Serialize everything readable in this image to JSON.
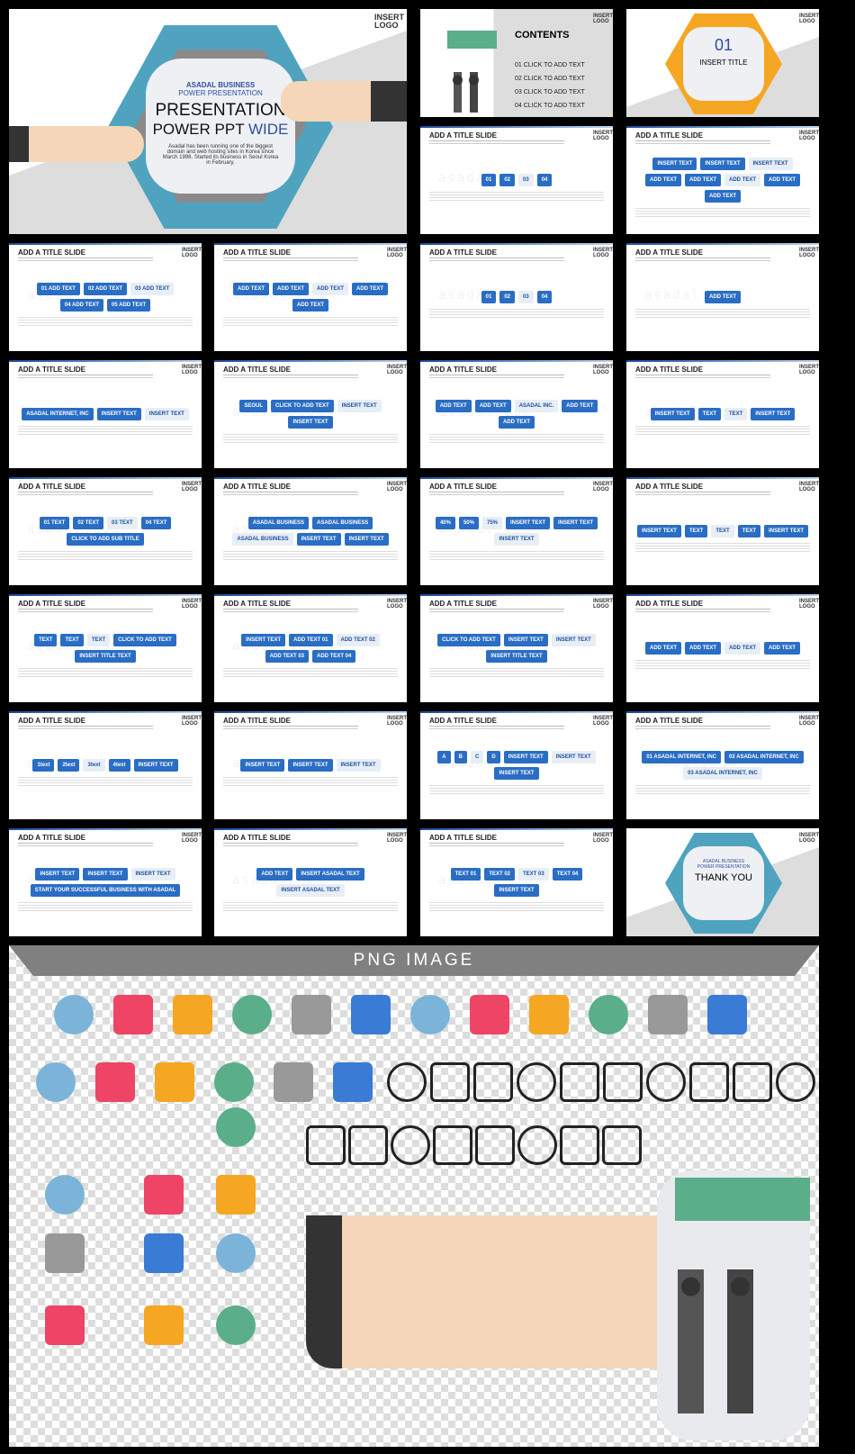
{
  "watermark": "asadal.com",
  "logo": "INSERT LOGO",
  "title_slide": {
    "kicker1": "ASADAL BUSINESS",
    "kicker2": "POWER PRESENTATION",
    "line1": "PRESENTATION",
    "line2a": "POWER PPT ",
    "line2b": "WIDE",
    "body": "Asadal has been running one of the biggest domain and web hosting sites in Korea since March 1998. Started its business in Seoul Korea in February."
  },
  "contents_slide": {
    "title": "CONTENTS",
    "items": [
      "01 CLICK TO ADD TEXT",
      "02 CLICK TO ADD TEXT",
      "03 CLICK TO ADD TEXT",
      "04 CLICK TO ADD TEXT"
    ]
  },
  "section_slide": {
    "number": "01",
    "title": "INSERT TITLE"
  },
  "slide_title": "ADD A TITLE SLIDE",
  "slides": [
    {
      "labels": [
        "01",
        "02",
        "03",
        "04"
      ]
    },
    {
      "labels": [
        "INSERT TEXT",
        "INSERT TEXT",
        "INSERT TEXT",
        "ADD TEXT",
        "ADD TEXT",
        "ADD TEXT",
        "ADD TEXT",
        "ADD TEXT"
      ]
    },
    {
      "labels": [
        "01 ADD TEXT",
        "02 ADD TEXT",
        "03 ADD TEXT",
        "04 ADD TEXT",
        "05 ADD TEXT"
      ]
    },
    {
      "labels": [
        "ADD TEXT",
        "ADD TEXT",
        "ADD TEXT",
        "ADD TEXT",
        "ADD TEXT"
      ]
    },
    {
      "labels": [
        "01",
        "02",
        "03",
        "04"
      ]
    },
    {
      "labels": [
        "ADD TEXT"
      ]
    },
    {
      "labels": [
        "ASADAL INTERNET, INC",
        "INSERT TEXT",
        "INSERT TEXT"
      ]
    },
    {
      "labels": [
        "SEOUL",
        "CLICK TO ADD TEXT",
        "INSERT TEXT",
        "INSERT TEXT"
      ]
    },
    {
      "labels": [
        "ADD TEXT",
        "ADD TEXT",
        "ASADAL INC.",
        "ADD TEXT",
        "ADD TEXT"
      ]
    },
    {
      "labels": [
        "INSERT TEXT",
        "TEXT",
        "TEXT",
        "INSERT TEXT"
      ]
    },
    {
      "labels": [
        "01 TEXT",
        "02 TEXT",
        "03 TEXT",
        "04 TEXT",
        "CLICK TO ADD SUB TITLE"
      ]
    },
    {
      "labels": [
        "ASADAL BUSINESS",
        "ASADAL BUSINESS",
        "ASADAL BUSINESS",
        "INSERT TEXT",
        "INSERT TEXT"
      ]
    },
    {
      "labels": [
        "40%",
        "50%",
        "75%",
        "INSERT TEXT",
        "INSERT TEXT",
        "INSERT TEXT"
      ]
    },
    {
      "labels": [
        "INSERT TEXT",
        "TEXT",
        "TEXT",
        "TEXT",
        "INSERT TEXT"
      ]
    },
    {
      "labels": [
        "TEXT",
        "TEXT",
        "TEXT",
        "CLICK TO ADD TEXT",
        "INSERT TITLE TEXT"
      ]
    },
    {
      "labels": [
        "INSERT TEXT",
        "ADD TEXT 01",
        "ADD TEXT 02",
        "ADD TEXT 03",
        "ADD TEXT 04"
      ]
    },
    {
      "labels": [
        "CLICK TO ADD TEXT",
        "INSERT TEXT",
        "INSERT TEXT",
        "INSERT TITLE TEXT"
      ]
    },
    {
      "labels": [
        "ADD TEXT",
        "ADD TEXT",
        "ADD TEXT",
        "ADD TEXT"
      ]
    },
    {
      "labels": [
        "1text",
        "2text",
        "3text",
        "4text",
        "INSERT TEXT"
      ]
    },
    {
      "labels": [
        "INSERT TEXT",
        "INSERT TEXT",
        "INSERT TEXT"
      ]
    },
    {
      "labels": [
        "A",
        "B",
        "C",
        "D",
        "INSERT TEXT",
        "INSERT TEXT",
        "INSERT TEXT"
      ]
    },
    {
      "labels": [
        "01 ASADAL INTERNET, INC",
        "02 ASADAL INTERNET, INC",
        "03 ASADAL INTERNET, INC"
      ]
    },
    {
      "labels": [
        "INSERT TEXT",
        "INSERT TEXT",
        "INSERT TEXT",
        "START YOUR SUCCESSFUL BUSINESS WITH ASADAL"
      ]
    },
    {
      "labels": [
        "ADD TEXT",
        "INSERT ASADAL TEXT",
        "INSERT ASADAL TEXT"
      ]
    },
    {
      "labels": [
        "TEXT 01",
        "TEXT 02",
        "TEXT 03",
        "TEXT 04",
        "INSERT TEXT"
      ]
    }
  ],
  "thanks_slide": {
    "kicker1": "ASADAL BUSINESS",
    "kicker2": "POWER PRESENTATION",
    "title": "THANK YOU"
  },
  "png_section": {
    "title": "PNG IMAGE",
    "icons": [
      "tooth",
      "credit-card",
      "folder",
      "usb-drive",
      "browser",
      "calendar",
      "signpost",
      "hourglass",
      "heart-rate",
      "syringe",
      "medicine-jar",
      "business-people",
      "dollar",
      "x-ray",
      "scales",
      "road-sign",
      "traffic-light",
      "target",
      "hand-pointer",
      "briefcase",
      "pills",
      "plug",
      "3d",
      "boot",
      "microscope",
      "clipboard-plus",
      "money-bag",
      "balloon",
      "pyramid",
      "molecule",
      "first-aid",
      "syringe-outline",
      "heart-pulse",
      "stethoscope",
      "test-tubes",
      "flask",
      "monitor",
      "graduate",
      "toolbox",
      "ambulance",
      "computer",
      "car",
      "train",
      "calculator",
      "stop-sign",
      "siren"
    ]
  },
  "colors": {
    "accent": "#2a6dc4",
    "teal": "#4fa3bf",
    "orange": "#f5a623",
    "gray": "#808080"
  }
}
